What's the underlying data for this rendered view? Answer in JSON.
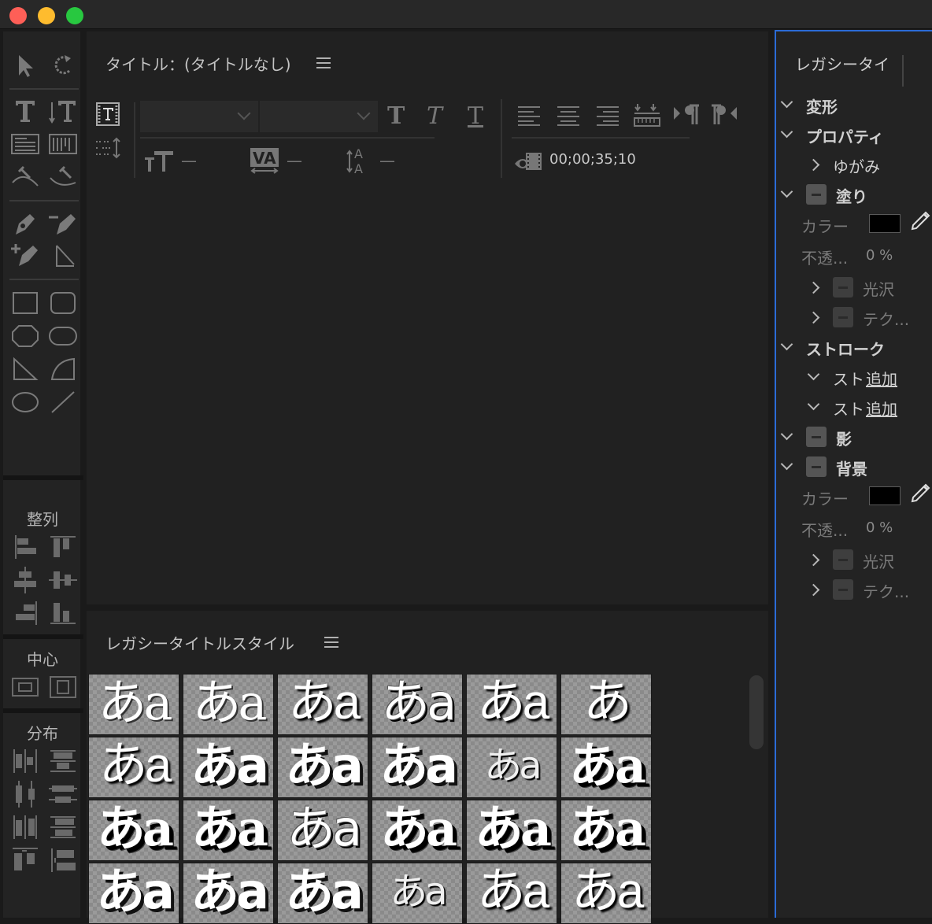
{
  "window": {
    "controls": [
      "close",
      "minimize",
      "zoom"
    ]
  },
  "toolbox": {
    "align_label": "整列",
    "center_label": "中心",
    "distribute_label": "分布"
  },
  "title_panel": {
    "title": "タイトル：(タイトルなし)",
    "timecode": "00;00;35;10",
    "font_family_value": "",
    "font_style_value": "",
    "font_size_value": "—",
    "kerning_value": "—",
    "leading_value": "—"
  },
  "styles_panel": {
    "title": "レガシータイトルスタイル",
    "swatch_text": "あa",
    "swatch_text_short": "あ",
    "rows": [
      [
        "a",
        "a",
        "c",
        "d",
        "c",
        "c"
      ],
      [
        "c",
        "b",
        "b",
        "b",
        "f",
        "e"
      ],
      [
        "e",
        "e",
        "d",
        "e",
        "e",
        "e"
      ],
      [
        "b",
        "b",
        "b",
        "f",
        "c",
        "c"
      ]
    ]
  },
  "properties_panel": {
    "title": "レガシータイ",
    "items": [
      {
        "label": "変形",
        "level": 0,
        "expanded": true,
        "bold": true
      },
      {
        "label": "プロパティ",
        "level": 0,
        "expanded": true,
        "bold": true
      },
      {
        "label": "ゆがみ",
        "level": 1,
        "expanded": false
      },
      {
        "label": "塗り",
        "level": 0,
        "expanded": true,
        "bold": true,
        "checkbox": true
      },
      {
        "label": "カラー",
        "type": "color",
        "color": "#000000"
      },
      {
        "label": "不透...",
        "type": "value",
        "value": "0 %"
      },
      {
        "label": "光沢",
        "level": 1,
        "expanded": false,
        "checkbox": true,
        "dim": true
      },
      {
        "label": "テク...",
        "level": 1,
        "expanded": false,
        "checkbox": true,
        "dim": true
      },
      {
        "label": "ストローク",
        "level": 0,
        "expanded": true,
        "bold": true
      },
      {
        "label": "スト",
        "link": "追加",
        "level": 1,
        "expanded": true
      },
      {
        "label": "スト",
        "link": "追加",
        "level": 1,
        "expanded": true
      },
      {
        "label": "影",
        "level": 0,
        "expanded": true,
        "bold": true,
        "checkbox": true
      },
      {
        "label": "背景",
        "level": 0,
        "expanded": true,
        "bold": true,
        "checkbox": true
      },
      {
        "label": "カラー",
        "type": "color",
        "color": "#000000"
      },
      {
        "label": "不透...",
        "type": "value",
        "value": "0 %"
      },
      {
        "label": "光沢",
        "level": 1,
        "expanded": false,
        "checkbox": true,
        "dim": true
      },
      {
        "label": "テク...",
        "level": 1,
        "expanded": false,
        "checkbox": true,
        "dim": true
      }
    ]
  },
  "colors": {
    "accent": "#2b6bd6",
    "panel": "#212121"
  }
}
